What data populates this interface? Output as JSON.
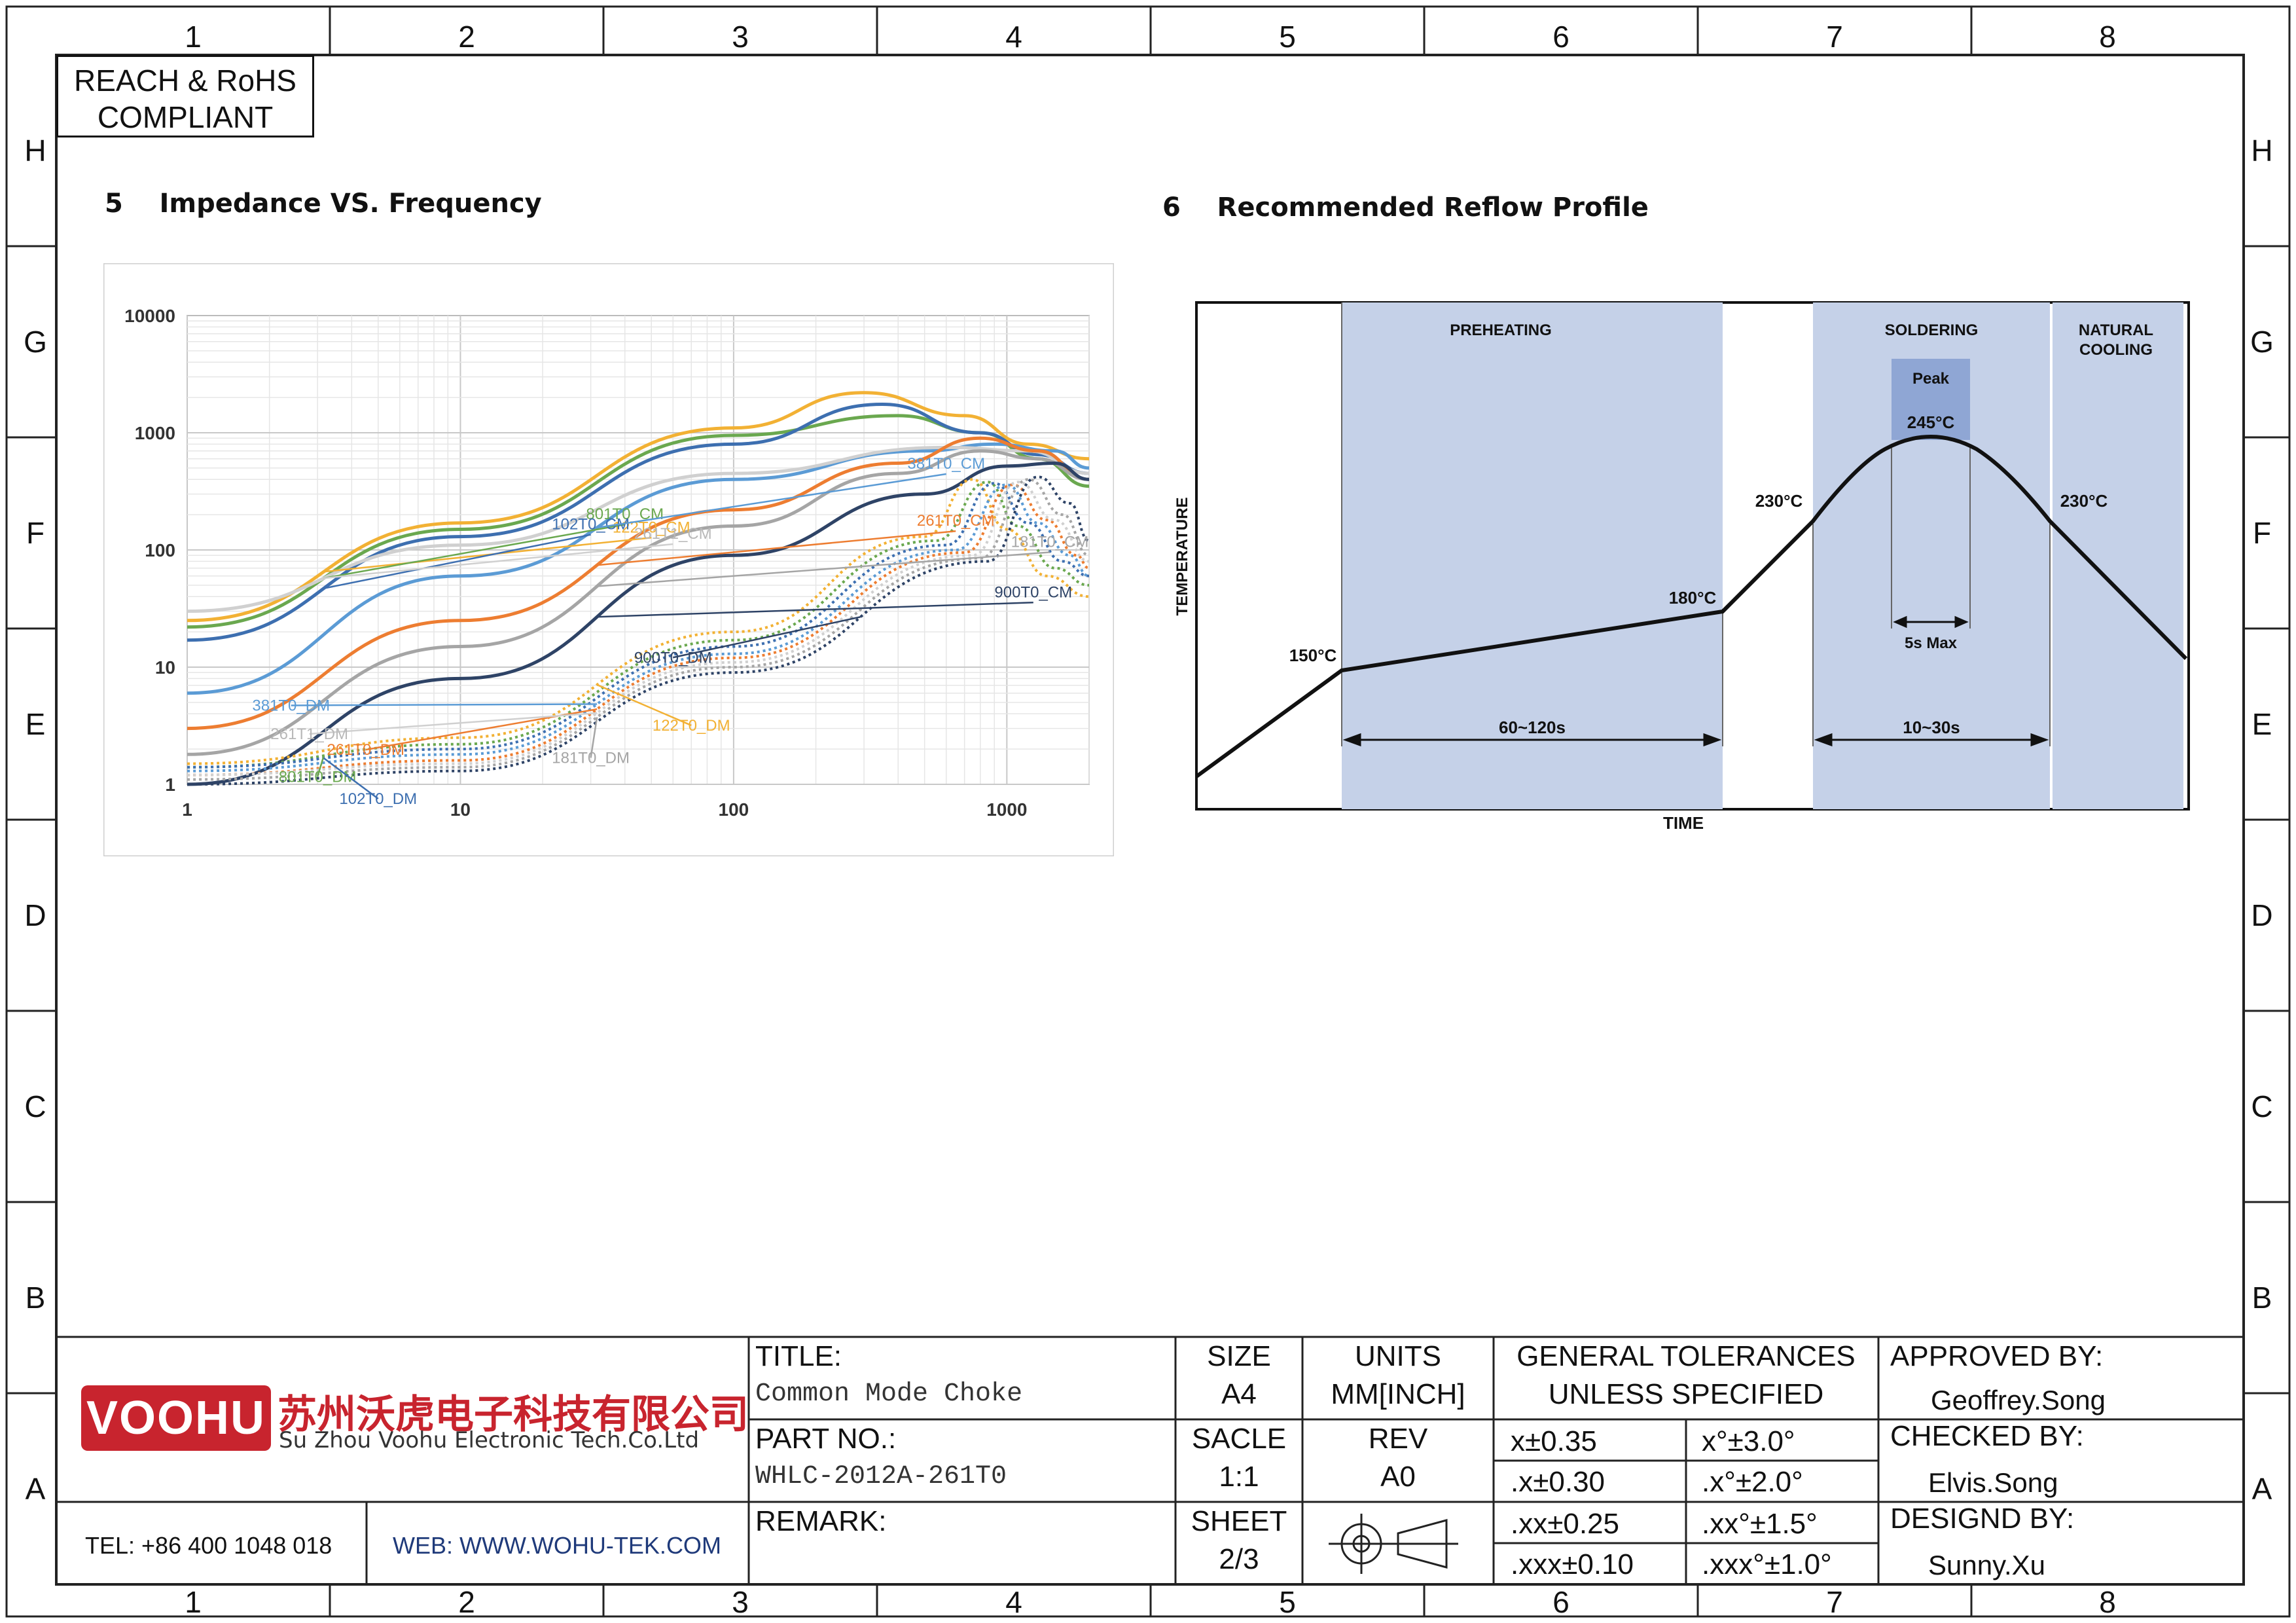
{
  "border": {
    "columns": [
      "1",
      "2",
      "3",
      "4",
      "5",
      "6",
      "7",
      "8"
    ],
    "rows": [
      "H",
      "G",
      "F",
      "E",
      "D",
      "C",
      "B",
      "A"
    ]
  },
  "compliance": [
    "REACH & RoHS",
    "COMPLIANT"
  ],
  "sections": {
    "impedance": {
      "number": "5",
      "title": "Impedance VS. Frequency"
    },
    "reflow": {
      "number": "6",
      "title": "Recommended Reflow Profile"
    }
  },
  "chart_data": [
    {
      "type": "line",
      "x_scale": "log",
      "y_scale": "log",
      "xlim": [
        1,
        2000
      ],
      "ylim": [
        1,
        10000
      ],
      "x_ticks": [
        "1",
        "10",
        "100",
        "1000"
      ],
      "y_ticks": [
        "10000",
        "1000",
        "100",
        "10",
        "1"
      ],
      "grid": true,
      "series": [
        {
          "name": "122T0_CM",
          "color": "#f2b134",
          "dashed": false,
          "x": [
            1,
            10,
            100,
            300,
            700,
            1200,
            2000
          ],
          "y": [
            25,
            170,
            1100,
            2200,
            1400,
            800,
            600
          ]
        },
        {
          "name": "801T0_CM",
          "color": "#6aa84f",
          "dashed": false,
          "x": [
            1,
            10,
            100,
            400,
            800,
            1300,
            2000
          ],
          "y": [
            22,
            150,
            950,
            1400,
            1000,
            600,
            350
          ]
        },
        {
          "name": "102T0_CM",
          "color": "#3d6fb0",
          "dashed": false,
          "x": [
            1,
            10,
            100,
            350,
            800,
            1300,
            2000
          ],
          "y": [
            17,
            130,
            800,
            1750,
            1000,
            650,
            450
          ]
        },
        {
          "name": "381T0_CM",
          "color": "#5b9bd5",
          "dashed": false,
          "x": [
            1,
            10,
            100,
            500,
            900,
            1500,
            2000
          ],
          "y": [
            6,
            60,
            400,
            700,
            800,
            700,
            500
          ]
        },
        {
          "name": "261T1_CM",
          "color": "#d0d0d0",
          "dashed": false,
          "x": [
            1,
            10,
            100,
            600,
            1200,
            2000
          ],
          "y": [
            30,
            110,
            450,
            750,
            700,
            450
          ]
        },
        {
          "name": "261T0_CM",
          "color": "#ed7d31",
          "dashed": false,
          "x": [
            1,
            10,
            100,
            400,
            800,
            1300,
            2000
          ],
          "y": [
            3,
            25,
            220,
            550,
            900,
            700,
            400
          ]
        },
        {
          "name": "181T0_CM",
          "color": "#a5a5a5",
          "dashed": false,
          "x": [
            1,
            10,
            100,
            400,
            800,
            1300,
            2000
          ],
          "y": [
            1.8,
            15,
            160,
            450,
            700,
            600,
            400
          ]
        },
        {
          "name": "900T0_CM",
          "color": "#2e4366",
          "dashed": false,
          "x": [
            1,
            10,
            100,
            500,
            1000,
            1500,
            2000
          ],
          "y": [
            1,
            8,
            90,
            300,
            520,
            550,
            400
          ]
        },
        {
          "name": "122T0_DM",
          "color": "#f2b134",
          "dashed": true,
          "x": [
            1,
            10,
            100,
            500,
            750,
            1000,
            1400,
            2000
          ],
          "y": [
            1.5,
            2.5,
            20,
            130,
            400,
            150,
            60,
            40
          ]
        },
        {
          "name": "801T0_DM",
          "color": "#6aa84f",
          "dashed": true,
          "x": [
            1,
            10,
            100,
            550,
            850,
            1100,
            1500,
            2000
          ],
          "y": [
            1.4,
            2.2,
            17,
            120,
            380,
            160,
            70,
            50
          ]
        },
        {
          "name": "102T0_DM",
          "color": "#3d6fb0",
          "dashed": true,
          "x": [
            1,
            10,
            100,
            600,
            900,
            1200,
            1600,
            2000
          ],
          "y": [
            1.4,
            2.0,
            15,
            110,
            370,
            170,
            80,
            60
          ]
        },
        {
          "name": "381T0_DM",
          "color": "#5b9bd5",
          "dashed": true,
          "x": [
            1,
            10,
            100,
            650,
            1000,
            1300,
            1700,
            2000
          ],
          "y": [
            1.3,
            1.8,
            13,
            100,
            360,
            170,
            90,
            60
          ]
        },
        {
          "name": "261T0_DM",
          "color": "#ed7d31",
          "dashed": true,
          "x": [
            1,
            10,
            100,
            700,
            1050,
            1400,
            1800,
            2000
          ],
          "y": [
            1.2,
            1.6,
            12,
            95,
            360,
            180,
            90,
            70
          ]
        },
        {
          "name": "261T1_DM",
          "color": "#d0d0d0",
          "dashed": true,
          "x": [
            1,
            10,
            100,
            750,
            1100,
            1500,
            2000
          ],
          "y": [
            1.2,
            1.5,
            11,
            90,
            380,
            180,
            80
          ]
        },
        {
          "name": "181T0_DM",
          "color": "#a5a5a5",
          "dashed": true,
          "x": [
            1,
            10,
            100,
            800,
            1200,
            1600,
            2000
          ],
          "y": [
            1.1,
            1.4,
            10,
            85,
            400,
            200,
            90
          ]
        },
        {
          "name": "900T0_DM",
          "color": "#2e4366",
          "dashed": true,
          "x": [
            1,
            10,
            100,
            850,
            1300,
            1700,
            2000
          ],
          "y": [
            1.0,
            1.3,
            9,
            80,
            420,
            250,
            120
          ]
        }
      ]
    },
    {
      "type": "line",
      "xlabel": "TIME",
      "ylabel": "TEMPERATURE",
      "zones": [
        "PREHEATING",
        "SOLDERING",
        "NATURAL COOLING"
      ],
      "zone_labels": {
        "preheating": "PREHEATING",
        "soldering": "SOLDERING",
        "cooling_1": "NATURAL",
        "cooling_2": "COOLING",
        "peak": "Peak"
      },
      "points": [
        {
          "label": "150°C",
          "value": 150
        },
        {
          "label": "180°C",
          "value": 180
        },
        {
          "label": "230°C",
          "value": 230
        },
        {
          "label": "245°C",
          "value": 245
        },
        {
          "label": "230°C",
          "value": 230
        }
      ],
      "labels": {
        "t150": "150°C",
        "t180": "180°C",
        "t230a": "230°C",
        "t245": "245°C",
        "t230b": "230°C"
      },
      "durations": {
        "preheat": "60~120s",
        "soldering": "10~30s",
        "peak": "5s Max"
      }
    }
  ],
  "title_block": {
    "company_logo": "VOOHU",
    "company_cn": "苏州沃虎电子科技有限公司",
    "company_en": "Su Zhou Voohu Electronic Tech.Co.Ltd",
    "tel": "TEL: +86 400 1048 018",
    "web": "WEB: WWW.WOHU-TEK.COM",
    "title_label": "TITLE:",
    "title_value": "Common Mode Choke",
    "part_label": "PART NO.:",
    "part_value": "WHLC-2012A-261T0",
    "remark_label": "REMARK:",
    "size_label": "SIZE",
    "size_value": "A4",
    "units_label": "UNITS",
    "units_value": "MM[INCH]",
    "scale_label": "SACLE",
    "scale_value": "1:1",
    "rev_label": "REV",
    "rev_value": "A0",
    "sheet_label": "SHEET",
    "sheet_value": "2/3",
    "tol_title_1": "GENERAL TOLERANCES",
    "tol_title_2": "UNLESS SPECIFIED",
    "tolerances": [
      {
        "linear": "x±0.35",
        "angular": "x°±3.0°"
      },
      {
        "linear": ".x±0.30",
        "angular": ".x°±2.0°"
      },
      {
        "linear": ".xx±0.25",
        "angular": ".xx°±1.5°"
      },
      {
        "linear": ".xxx±0.10",
        "angular": ".xxx°±1.0°"
      }
    ],
    "approved_label": "APPROVED BY:",
    "approved_value": "Geoffrey.Song",
    "checked_label": "CHECKED BY:",
    "checked_value": "Elvis.Song",
    "designed_label": "DESIGND BY:",
    "designed_value": "Sunny.Xu"
  }
}
